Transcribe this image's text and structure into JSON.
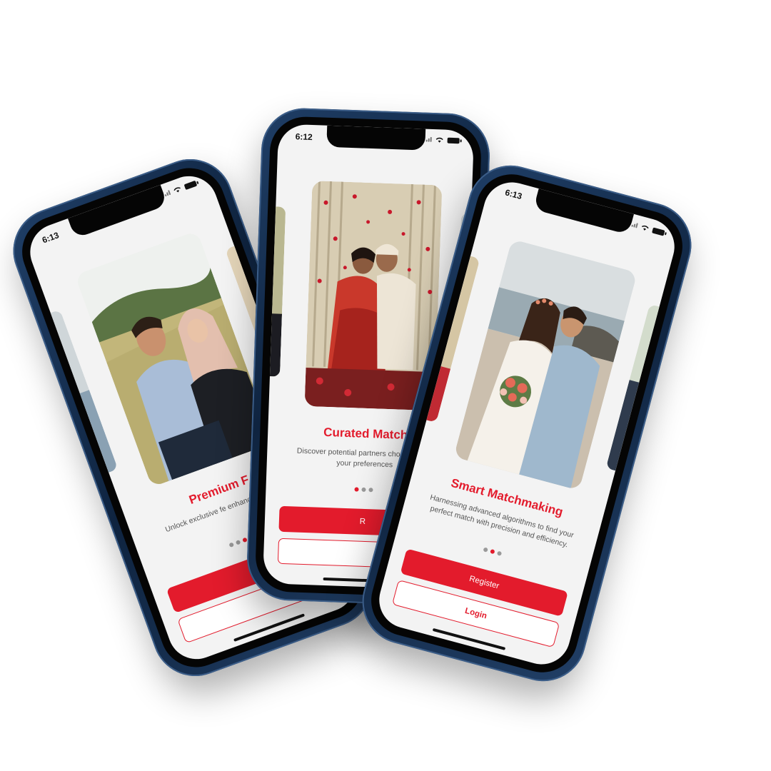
{
  "colors": {
    "accent": "#e31b2c",
    "frame": "#1b3558",
    "screen_bg": "#f3f3f3"
  },
  "phones": {
    "left": {
      "status_time": "6:13",
      "title": "Premium F",
      "description": "Unlock exclusive fe enhanced and sea",
      "photo": "couple-hijab-field-photo",
      "active_dot": 3
    },
    "center": {
      "status_time": "6:12",
      "title": "Curated Match",
      "description": "Discover potential partners cho based on your preferences",
      "register_label": "R",
      "photo": "couple-wedding-petals-photo",
      "active_dot": 1
    },
    "right": {
      "status_time": "6:13",
      "title": "Smart Matchmaking",
      "description": "Harnessing advanced algorithms to find your perfect match with precision and efficiency.",
      "register_label": "Register",
      "login_label": "Login",
      "photo": "couple-beach-bouquet-photo",
      "active_dot": 2
    }
  }
}
